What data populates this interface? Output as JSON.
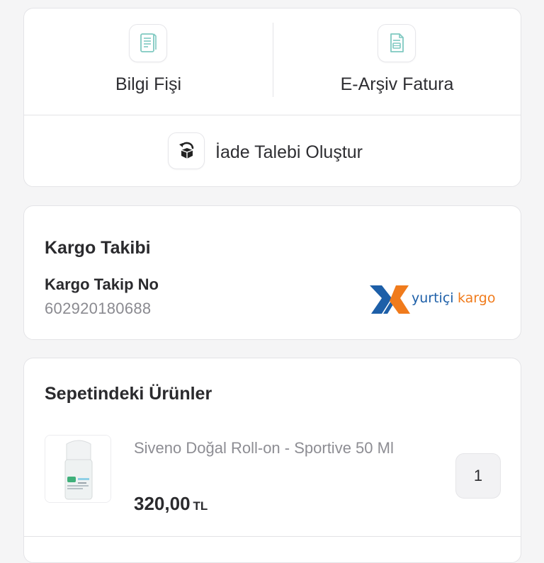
{
  "documents": {
    "info_receipt": {
      "label": "Bilgi Fişi",
      "icon": "receipt-icon"
    },
    "e_archive_invoice": {
      "label": "E-Arşiv Fatura",
      "icon": "invoice-icon"
    },
    "return_request": {
      "label": "İade Talebi Oluştur",
      "icon": "return-box-icon"
    }
  },
  "cargo": {
    "title": "Kargo Takibi",
    "tracking_label": "Kargo Takip No",
    "tracking_number": "602920180688",
    "carrier_logo_text": {
      "first": "yurtiçi",
      "second": "kargo"
    },
    "colors": {
      "blue": "#1d5fa8",
      "orange": "#f07b1c"
    }
  },
  "basket": {
    "title": "Sepetindeki Ürünler",
    "items": [
      {
        "name": "Siveno Doğal Roll-on - Sportive 50 Ml",
        "price": "320,00",
        "currency": "TL",
        "quantity": "1"
      }
    ]
  }
}
